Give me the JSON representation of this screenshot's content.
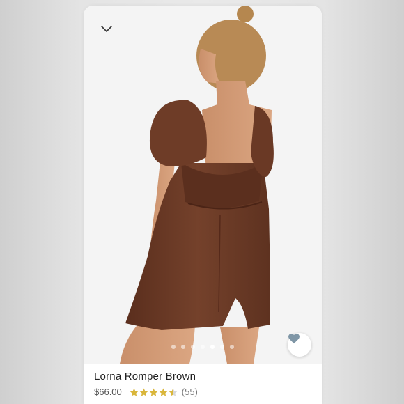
{
  "product": {
    "title": "Lorna Romper Brown",
    "price": "$66.00",
    "rating": 4.5,
    "rating_max": 5,
    "review_count": "(55)"
  },
  "gallery": {
    "slide_count": 7,
    "active_slide": 5
  },
  "icons": {
    "collapse": "chevron-down-icon",
    "favorite": "heart-icon",
    "star": "star-icon"
  },
  "colors": {
    "garment": "#6b3a26",
    "star": "#d9b63b",
    "favorite_icon": "#7f96a6"
  }
}
